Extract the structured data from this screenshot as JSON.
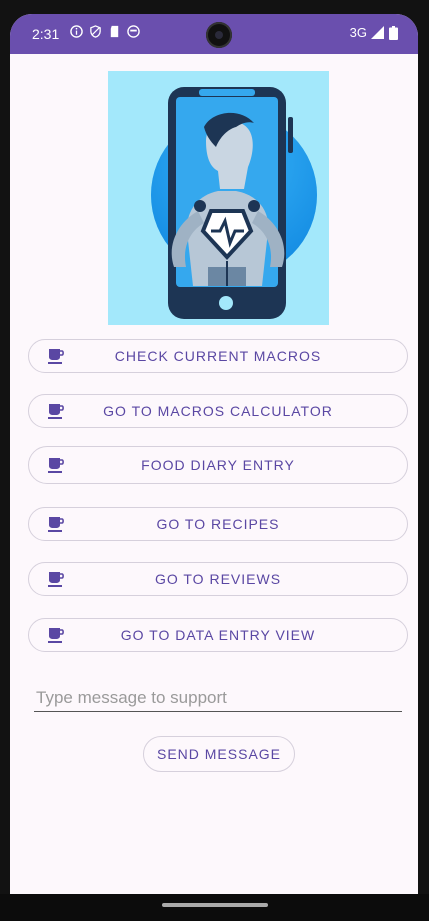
{
  "status_bar": {
    "time": "2:31",
    "network": "3G",
    "bg_color": "#6a4fae"
  },
  "hero": {
    "icon": "fitness-phone-illustration"
  },
  "menu": {
    "buttons": [
      {
        "label": "CHECK CURRENT MACROS"
      },
      {
        "label": "GO TO MACROS CALCULATOR"
      },
      {
        "label": "FOOD DIARY ENTRY"
      },
      {
        "label": "GO TO RECIPES"
      },
      {
        "label": "GO TO REVIEWS"
      },
      {
        "label": "GO TO DATA ENTRY VIEW"
      }
    ]
  },
  "support": {
    "placeholder": "Type message to support",
    "value": "",
    "send_label": "SEND MESSAGE"
  },
  "colors": {
    "accent": "#5a47a3",
    "screen_bg": "#fdf8fc"
  }
}
